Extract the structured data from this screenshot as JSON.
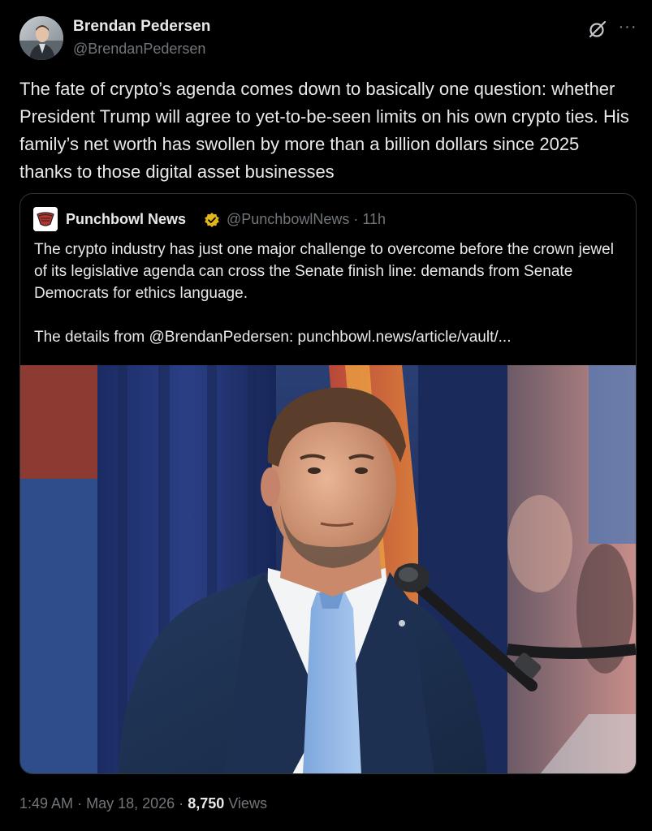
{
  "post": {
    "author": {
      "name": "Brendan Pedersen",
      "handle": "@BrendanPedersen"
    },
    "text": "The fate of crypto’s agenda comes down to basically one question: whether President Trump will agree to yet-to-be-seen limits on his own crypto ties. His family’s net worth has swollen by more than a billion dollars since 2025 thanks to those digital asset businesses",
    "icons": {
      "grok": "grok-icon",
      "more": "more-icon",
      "more_glyph": "···"
    },
    "quote": {
      "name": "Punchbowl News",
      "verified_icon": "verified-badge-icon",
      "handle": "@PunchbowlNews",
      "separator": "·",
      "time": "11h",
      "text": "The crypto industry has just one major challenge to overcome before the crown jewel of its legislative agenda can cross the Senate finish line: demands from Senate Democrats for ethics language.",
      "details": "The details from @BrendanPedersen: punchbowl.news/article/vault/..."
    },
    "footer": {
      "time": "1:49 AM",
      "dot": "·",
      "date": "May 18, 2026",
      "views_count": "8,750",
      "views_label": "Views"
    }
  },
  "colors": {
    "background": "#000000",
    "text_primary": "#e7e9ea",
    "text_secondary": "#71767b",
    "border": "#2f3336",
    "verified_gold": "#e2b719"
  }
}
